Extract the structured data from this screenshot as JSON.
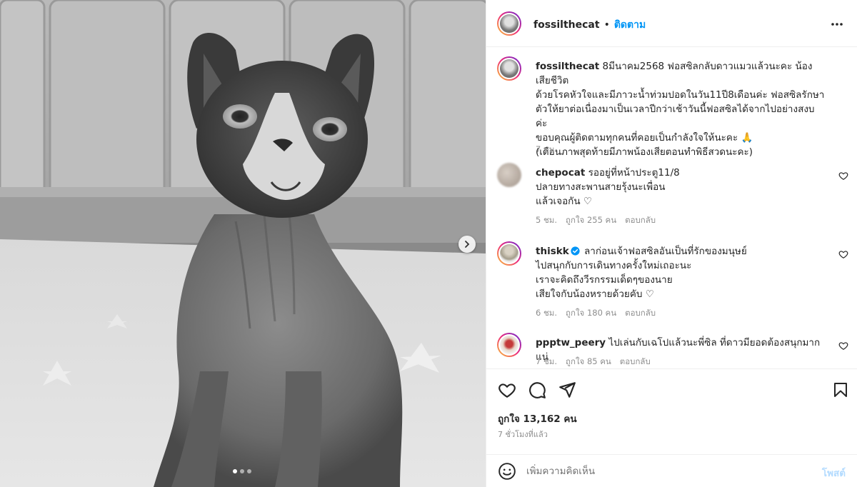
{
  "post": {
    "username": "fossilthecat",
    "separator": "•",
    "follow_label": "ติดตาม",
    "caption": {
      "username": "fossilthecat",
      "text": " 8มีนาคม2568 ฟอสซิลกลับดาวแมวแล้วนะคะ น้องเสียชีวิต\nด้วยโรคหัวใจและมีภาวะน้ำท่วมปอดในวัน11ปี8เดือนค่ะ ฟอสซิลรักษา\nตัวให้ยาต่อเนื่องมาเป็นเวลาปีกว่าเช้าวันนี้ฟอสซิลได้จากไปอย่างสงบค่ะ\nขอบคุณผู้ติดตามทุกคนที่คอยเป็นกำลังใจให้นะคะ 🙏\n(เดือนภาพสุดท้ายมีภาพน้องเสียตอนทำพิธีสวดนะคะ)",
      "time": "7 ชม."
    },
    "comments": [
      {
        "username": "chepocat",
        "verified": false,
        "text": " รออยู่ที่หน้าประตู11/8\nปลายทางสะพานสายรุ้งนะเพื่อน\nแล้วเจอกัน ♡",
        "time": "5 ชม.",
        "likes": "ถูกใจ 255 คน",
        "reply": "ตอบกลับ"
      },
      {
        "username": "thiskk",
        "verified": true,
        "text": " ลาก่อนเจ้าฟอสซิลอันเป็นที่รักของมนุษย์\nไปสนุกกับการเดินทางครั้งใหม่เถอะนะ\nเราจะคิดถึงวีรกรรมเด็ดๆของนาย\nเสียใจกับน้องหรายด้วยคับ ♡",
        "time": "6 ชม.",
        "likes": "ถูกใจ 180 คน",
        "reply": "ตอบกลับ"
      },
      {
        "username": "ppptw_peery",
        "verified": false,
        "text": " ไปเล่นกับเฉโปแล้วนะพี่ซิล ที่ดาวมียอดต้องสนุกมากแน่",
        "time": "7 ชม.",
        "likes": "ถูกใจ 85 คน",
        "reply": "ตอบกลับ"
      }
    ],
    "likes_count": "ถูกใจ 13,162 คน",
    "posted_ago": "7 ชั่วโมงที่แล้ว",
    "comment_placeholder": "เพิ่มความคิดเห็น",
    "post_button": "โพสต์"
  },
  "carousel": {
    "current": 1,
    "total": 3
  },
  "icons": {
    "more": "more-horizontal-icon",
    "like": "heart-icon",
    "comment": "comment-bubble-icon",
    "share": "paper-plane-icon",
    "save": "bookmark-icon",
    "emoji": "smiley-icon",
    "next": "chevron-right-icon",
    "verified": "verified-badge-icon"
  },
  "colors": {
    "accent": "#0095f6",
    "text": "#262626",
    "muted": "#8e8e8e",
    "post_disabled": "#b3dbff"
  }
}
